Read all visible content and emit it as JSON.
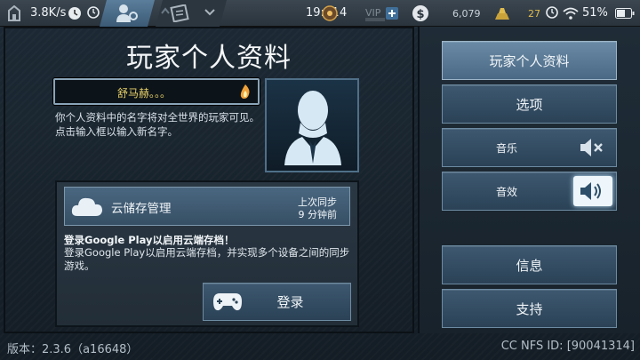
{
  "status_bar": {
    "net_speed": "3.8K/s",
    "time": "19:41",
    "rank_value": "4",
    "vip_label": "VIP",
    "cash_value": "6,079",
    "gold_value": "27",
    "battery": "51%"
  },
  "profile": {
    "title": "玩家个人资料",
    "player_name": "舒马赫。。。",
    "hint": "你个人资料中的名字将对全世界的玩家可见。点击输入框以输入新名字。"
  },
  "cloud": {
    "title": "云储存管理",
    "last_sync_label": "上次同步",
    "last_sync_value": "9 分钟前",
    "enable_title": "登录Google Play以启用云端存档！",
    "enable_desc": "登录Google Play以启用云端存档，并实现多个设备之间的同步游戏。",
    "login_label": "登录"
  },
  "menu": {
    "profile_label": "玩家个人资料",
    "options_label": "选项",
    "music_label": "音乐",
    "sfx_label": "音效",
    "info_label": "信息",
    "support_label": "支持"
  },
  "footer": {
    "version": "版本：2.3.6（a16648）",
    "cc_id": "CC NFS ID: [90041314]"
  },
  "colors": {
    "accent": "#5f7f9c",
    "name_text": "#e8d06a",
    "background": "#1a2630"
  }
}
